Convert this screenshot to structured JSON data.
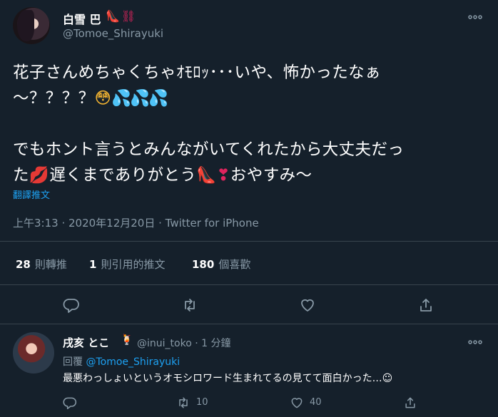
{
  "tweet": {
    "display_name": "白雪 巴",
    "name_emoji": "👠⛓",
    "handle": "@Tomoe_Shirayuki",
    "lines": [
      [
        "花子さんめちゃくちゃｵﾓﾛｯ･･･いや、怖かったなぁ"
      ],
      [
        "～？？？？",
        "😳",
        "💦💦💦"
      ],
      [],
      [
        "でもホント言うとみんながいてくれたから大丈夫だっ"
      ],
      [
        "た",
        "💋",
        "遅くまでありがとう",
        "👠",
        "❣",
        "おやすみ～"
      ]
    ],
    "translate_label": "翻譯推文",
    "meta": "上午3:13 · 2020年12月20日 · Twitter for iPhone",
    "stats": [
      {
        "count": "28",
        "label": "則轉推"
      },
      {
        "count": "1",
        "label": "則引用的推文"
      },
      {
        "count": "180",
        "label": "個喜歡"
      }
    ]
  },
  "reply": {
    "display_name": "戌亥 とこ",
    "name_emoji": "🍹",
    "handle": "@inui_toko · 1 分鐘",
    "replying_prefix": "回覆",
    "replying_to": "@Tomoe_Shirayuki",
    "text": "最悪わっしょいというオモシロワード生まれてるの見てて面白かった…☺",
    "retweet_count": "10",
    "like_count": "40"
  },
  "colors": {
    "background": "#15202b",
    "border": "#38444d",
    "secondary_text": "#8899a6",
    "accent": "#1da1f2"
  },
  "icons": [
    "more-icon",
    "reply-icon",
    "retweet-icon",
    "like-icon",
    "share-icon"
  ]
}
